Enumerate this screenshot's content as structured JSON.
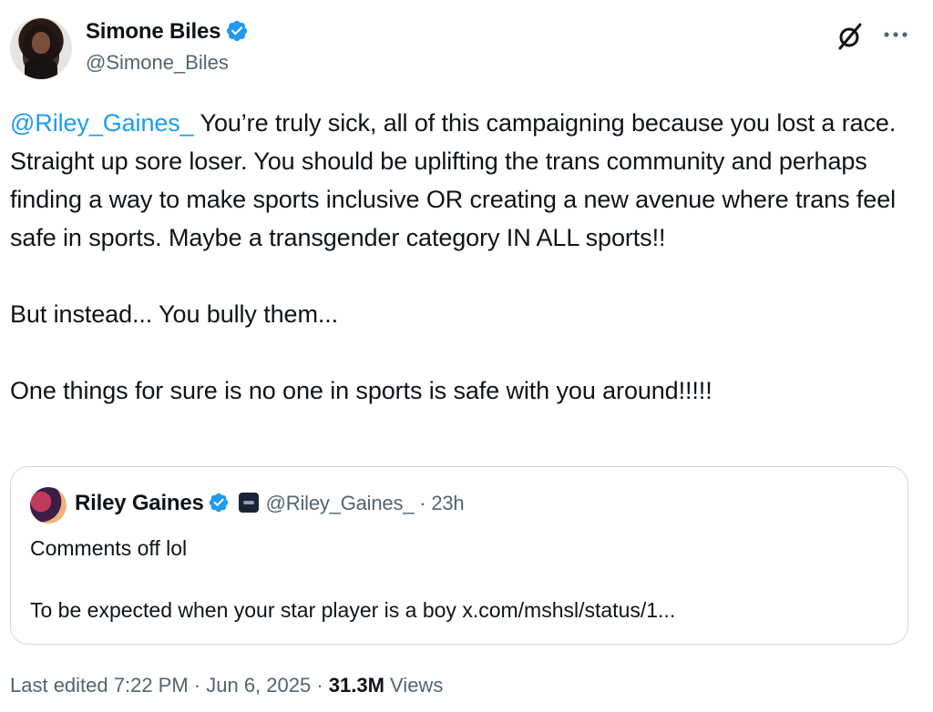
{
  "author": {
    "display_name": "Simone Biles",
    "handle": "@Simone_Biles",
    "verified": true
  },
  "header_icons": [
    "grok-icon",
    "more-icon"
  ],
  "tweet": {
    "mention": "@Riley_Gaines_",
    "body": " You’re truly sick, all of this campaigning because you lost a race. Straight up sore loser. You should be uplifting the trans community and perhaps finding a way to make sports inclusive OR creating a new avenue where trans feel safe in sports. Maybe a transgender category IN ALL sports!!\n\nBut instead... You bully them...\n\nOne things for sure is no one in sports is safe with you around!!!!!"
  },
  "quote": {
    "display_name": "Riley Gaines",
    "verified": true,
    "handle": "@Riley_Gaines_",
    "time": "· 23h",
    "text": "Comments off lol\n\nTo be expected when your star player is a boy x.com/mshsl/status/1..."
  },
  "footer": {
    "edited": "Last edited 7:22 PM · Jun 6, 2025 · ",
    "views_count": "31.3M",
    "views_label": " Views"
  },
  "colors": {
    "accent": "#1d9bf0",
    "text": "#0f1419",
    "secondary": "#536471",
    "border": "#cfd9de"
  }
}
